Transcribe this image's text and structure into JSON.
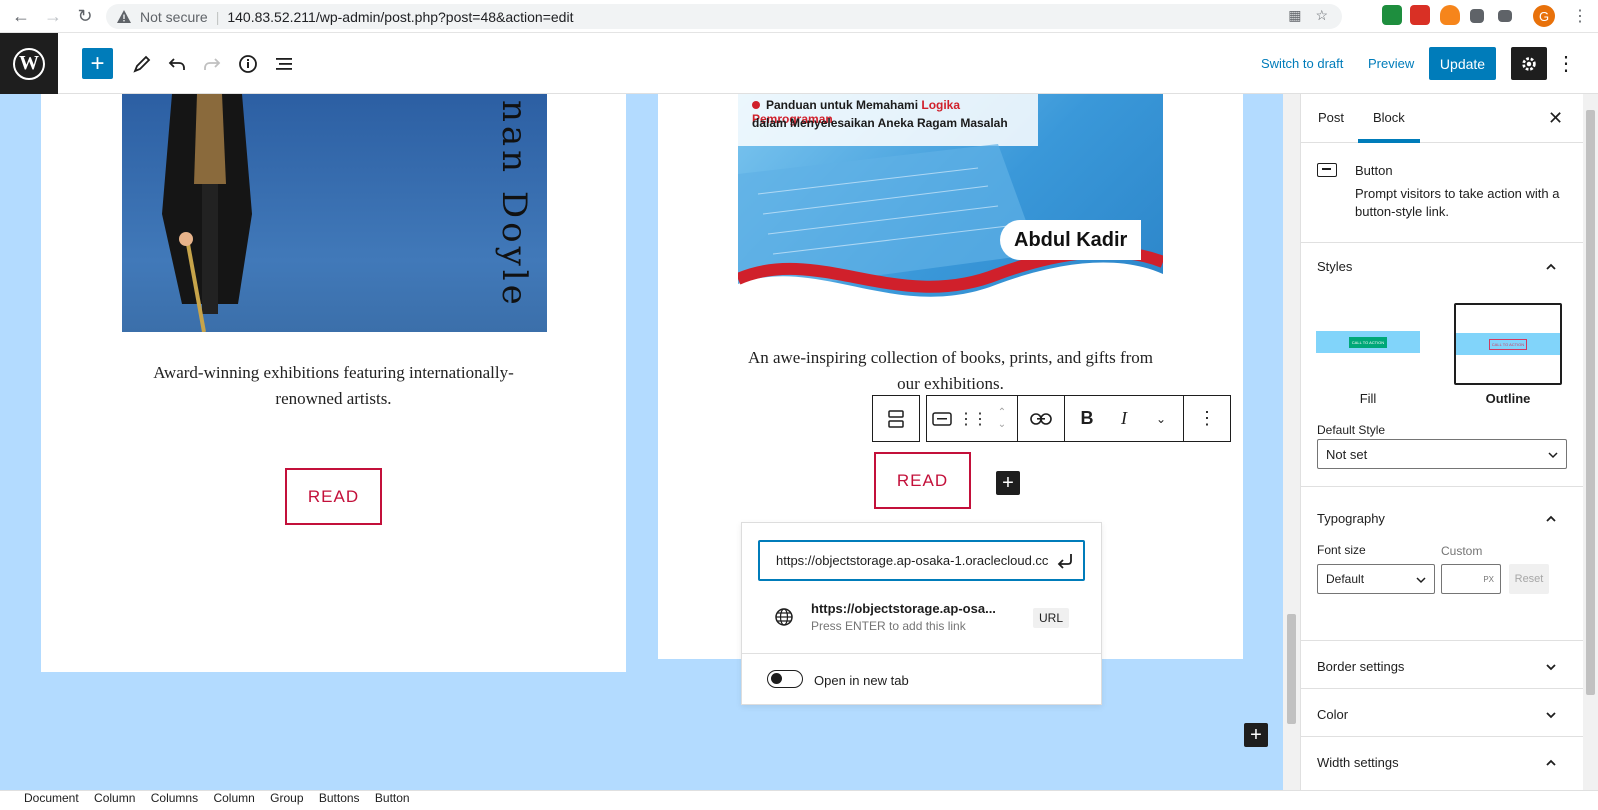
{
  "browser": {
    "security_label": "Not secure",
    "url": "140.83.52.211/wp-admin/post.php?post=48&action=edit",
    "avatar_letter": "G"
  },
  "editor_toolbar": {
    "switch_to_draft": "Switch to draft",
    "preview": "Preview",
    "update": "Update"
  },
  "canvas": {
    "cover1_author_text": "nan Doyle",
    "cover2_line1_prefix": "Panduan untuk Memahami ",
    "cover2_line1_highlight": "Logika Pemrograman",
    "cover2_line2": "dalam Menyelesaikan Aneka Ragam Masalah",
    "cover2_author": "Abdul Kadir",
    "excerpt1": "Award-winning exhibitions featuring internationally-renowned artists.",
    "excerpt2": "An awe-inspiring collection of books, prints, and gifts from our exhibitions.",
    "button1_label": "READ",
    "button2_label": "READ"
  },
  "link_popover": {
    "input_value": "https://objectstorage.ap-osaka-1.oraclecloud.cc",
    "suggestion_title": "https://objectstorage.ap-osa...",
    "suggestion_sub": "Press ENTER to add this link",
    "suggestion_tag": "URL",
    "toggle_label": "Open in new tab"
  },
  "sidebar": {
    "tabs": [
      "Post",
      "Block"
    ],
    "active_tab": "Block",
    "block_title": "Button",
    "block_desc": "Prompt visitors to take action with a button-style link.",
    "styles_title": "Styles",
    "style_fill_label": "Fill",
    "style_outline_label": "Outline",
    "style_preview_text": "CALL TO ACTION",
    "default_style_label": "Default Style",
    "default_style_value": "Not set",
    "typography_title": "Typography",
    "font_size_label": "Font size",
    "custom_label": "Custom",
    "font_size_value": "Default",
    "custom_unit": "PX",
    "reset_label": "Reset",
    "border_settings": "Border settings",
    "color": "Color",
    "width_settings": "Width settings"
  },
  "footer": {
    "breadcrumb": [
      "Document",
      "Column",
      "Columns",
      "Column",
      "Group",
      "Buttons",
      "Button"
    ]
  },
  "colors": {
    "accent": "#007cba",
    "canvas_bg": "#b3dbff",
    "button_outline": "#c3103a"
  }
}
